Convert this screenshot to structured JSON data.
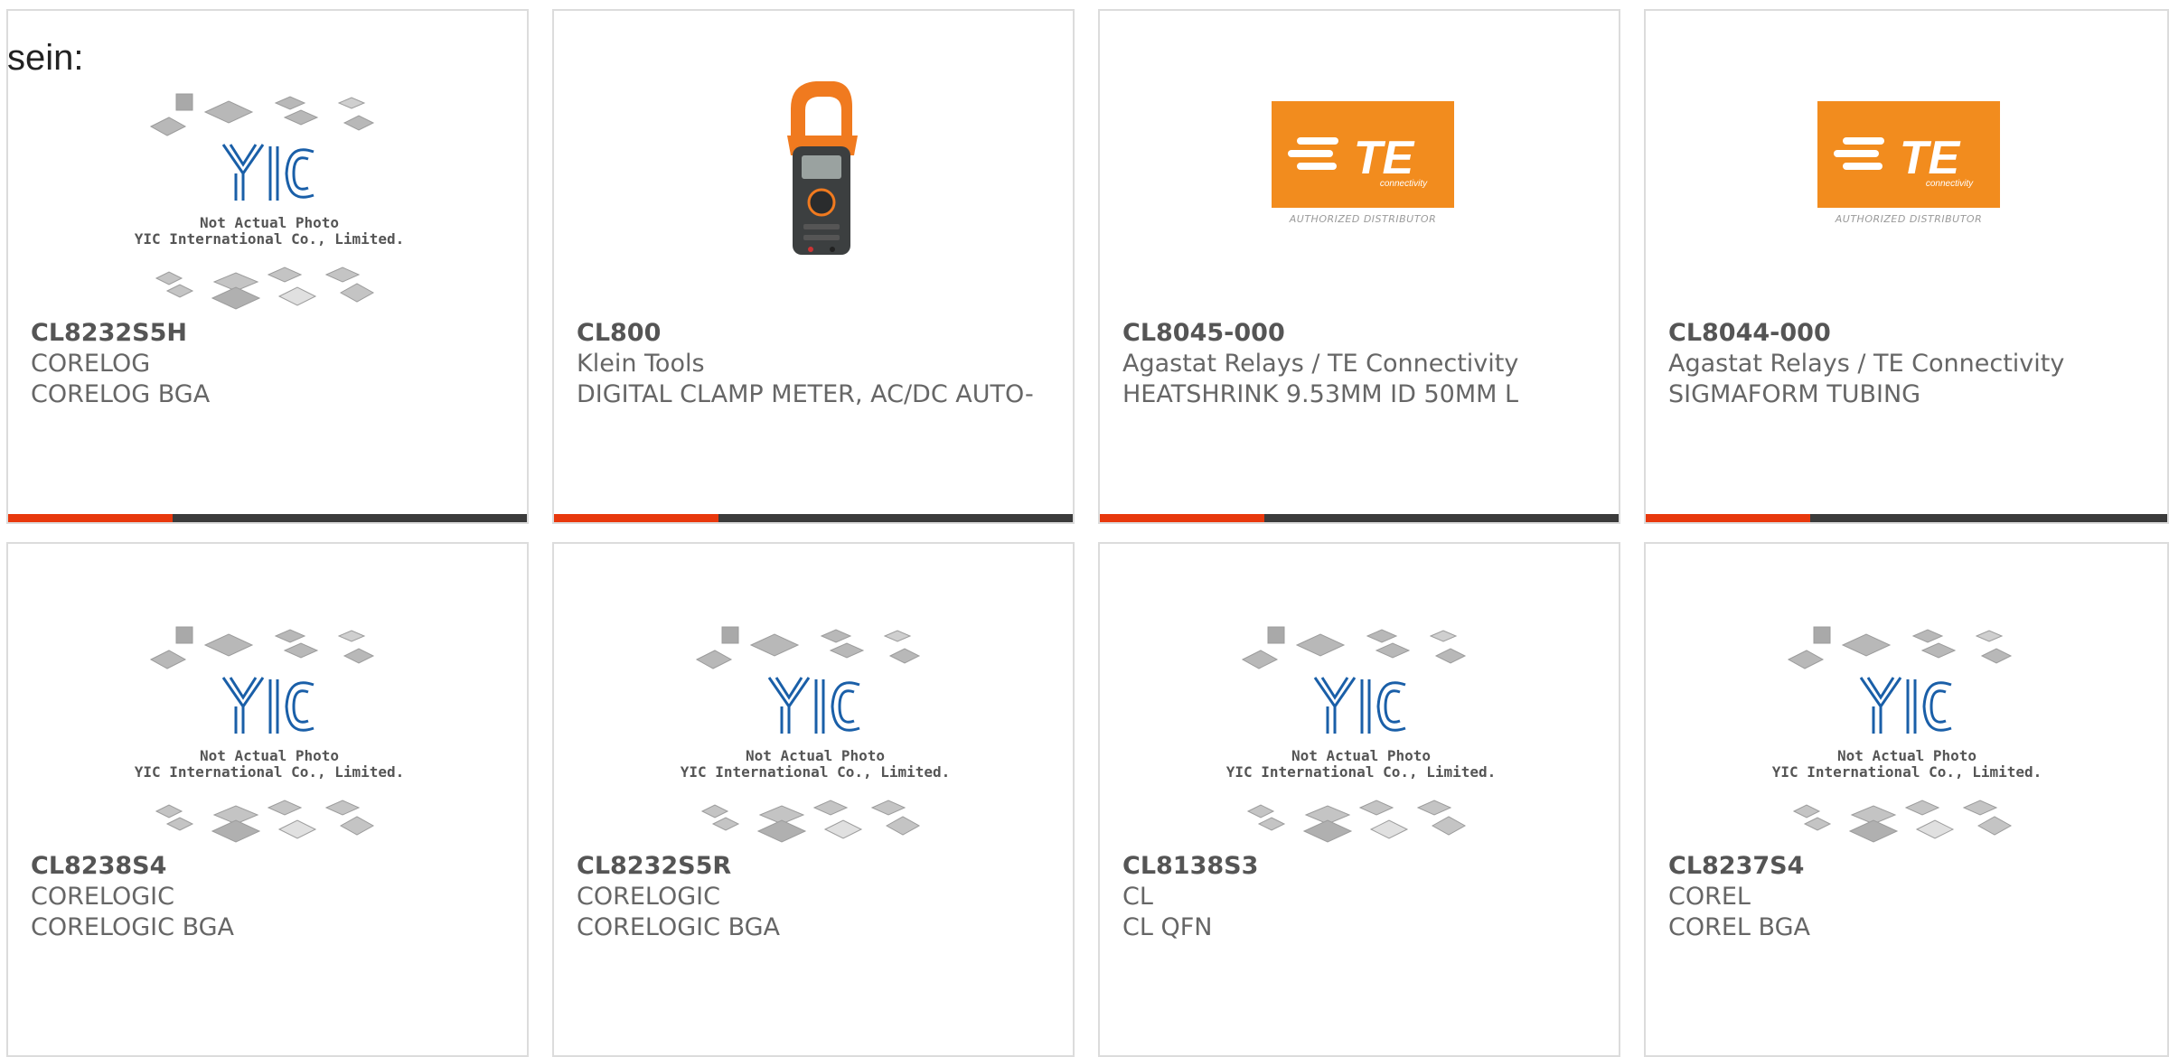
{
  "intro_text": "sein:",
  "placeholder_caption": {
    "line1": "Not Actual Photo",
    "line2": "YIC International Co., Limited."
  },
  "te_logo": {
    "wordmark": "TE",
    "sub": "connectivity",
    "tagline": "AUTHORIZED DISTRIBUTOR"
  },
  "colors": {
    "accent": "#e8380d",
    "bar": "#3b3b3b",
    "te_orange": "#f28c1e",
    "yic_blue": "#1a5fa8"
  },
  "products": [
    {
      "part": "CL8232S5H",
      "maker": "CORELOG",
      "desc": "CORELOG BGA",
      "image": "yic-placeholder"
    },
    {
      "part": "CL800",
      "maker": "Klein Tools",
      "desc": "DIGITAL CLAMP METER, AC/DC AUTO-",
      "image": "clamp-meter"
    },
    {
      "part": "CL8045-000",
      "maker": "Agastat Relays / TE Connectivity",
      "desc": "HEATSHRINK 9.53MM ID 50MM L",
      "image": "te-logo"
    },
    {
      "part": "CL8044-000",
      "maker": "Agastat Relays / TE Connectivity",
      "desc": "SIGMAFORM TUBING",
      "image": "te-logo"
    },
    {
      "part": "CL8238S4",
      "maker": "CORELOGIC",
      "desc": "CORELOGIC BGA",
      "image": "yic-placeholder"
    },
    {
      "part": "CL8232S5R",
      "maker": "CORELOGIC",
      "desc": "CORELOGIC BGA",
      "image": "yic-placeholder"
    },
    {
      "part": "CL8138S3",
      "maker": "CL",
      "desc": "CL QFN",
      "image": "yic-placeholder"
    },
    {
      "part": "CL8237S4",
      "maker": "COREL",
      "desc": "COREL BGA",
      "image": "yic-placeholder"
    }
  ]
}
